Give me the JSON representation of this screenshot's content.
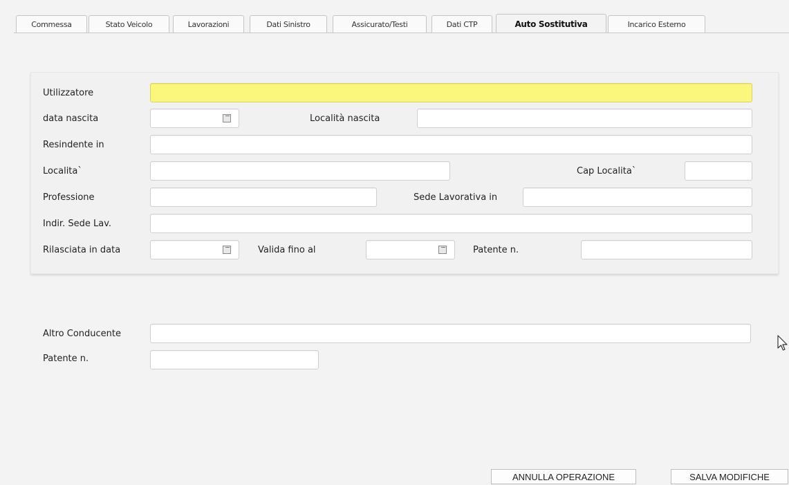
{
  "tabs": [
    {
      "label": "Commessa"
    },
    {
      "label": "Stato Veicolo"
    },
    {
      "label": "Lavorazioni"
    },
    {
      "label": "Dati Sinistro"
    },
    {
      "label": "Assicurato/Testi"
    },
    {
      "label": "Dati CTP"
    },
    {
      "label": "Auto Sostitutiva",
      "active": true
    },
    {
      "label": "Incarico Esterno"
    }
  ],
  "form": {
    "utilizzatore_label": "Utilizzatore",
    "data_nascita_label": "data nascita",
    "localita_nascita_label": "Località nascita",
    "residente_label": "Resindente in",
    "localita_label": "Localita`",
    "cap_label": "Cap Localita`",
    "professione_label": "Professione",
    "sede_label": "Sede Lavorativa in",
    "indir_sede_label": "Indir. Sede Lav.",
    "rilasciata_label": "Rilasciata in data",
    "valida_label": "Valida fino al",
    "patente_label": "Patente n."
  },
  "altro": {
    "conducente_label": "Altro Conducente",
    "patente_label": "Patente n."
  },
  "buttons": {
    "annulla": "ANNULLA OPERAZIONE",
    "salva": "SALVA MODIFICHE"
  },
  "colors": {
    "highlight_field": "#fbf67c"
  },
  "icons": {
    "date_picker": "calendar-icon",
    "pointer": "mouse-cursor-icon"
  }
}
